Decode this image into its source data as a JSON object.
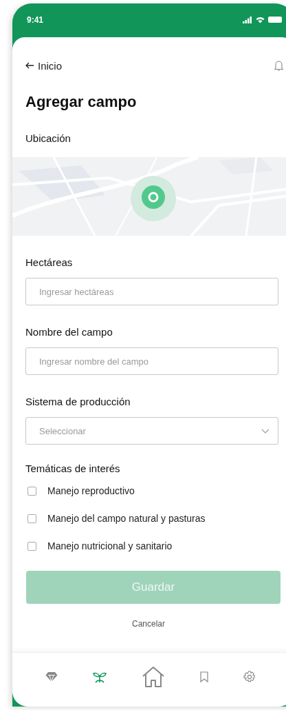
{
  "status_bar": {
    "time": "9:41"
  },
  "header": {
    "back_label": "Inicio"
  },
  "title": "Agregar campo",
  "location": {
    "label": "Ubicación"
  },
  "fields": [
    {
      "kind": "input",
      "label": "Hectáreas",
      "placeholder": "Ingresar hectáreas"
    },
    {
      "kind": "input",
      "label": "Nombre del campo",
      "placeholder": "Ingresar nombre del campo"
    },
    {
      "kind": "select",
      "label": "Sistema de producción",
      "placeholder": "Seleccionar"
    }
  ],
  "topics": {
    "label": "Temáticas de interés",
    "items": [
      {
        "label": "Manejo reproductivo",
        "checked": false
      },
      {
        "label": "Manejo del campo natural y pasturas",
        "checked": false
      },
      {
        "label": "Manejo nutricional y sanitario",
        "checked": false
      }
    ]
  },
  "save_button": {
    "label": "Guardar",
    "disabled": true
  },
  "cancel_link": "Cancelar",
  "bottom_nav": [
    {
      "selected": false
    },
    {
      "selected": true
    },
    {
      "selected": false
    },
    {
      "selected": false
    },
    {
      "selected": false
    }
  ]
}
